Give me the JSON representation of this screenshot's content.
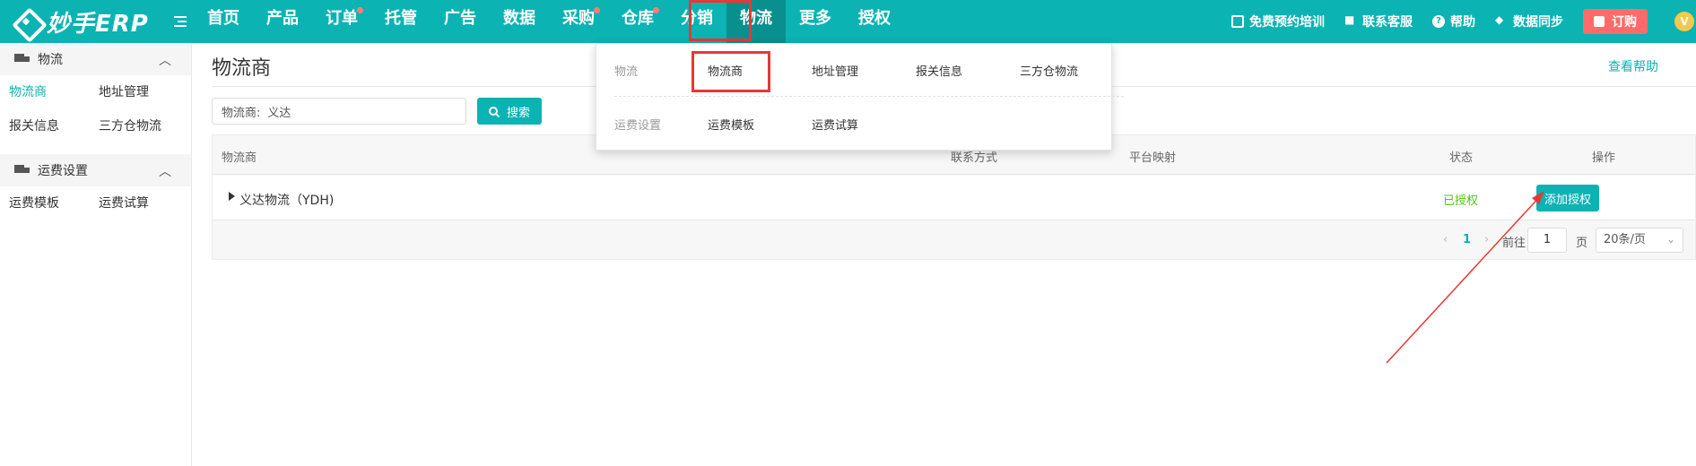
{
  "brand": {
    "name": "妙手ERP"
  },
  "nav": {
    "items": [
      {
        "label": "首页",
        "dot": false
      },
      {
        "label": "产品",
        "dot": false
      },
      {
        "label": "订单",
        "dot": true
      },
      {
        "label": "托管",
        "dot": false
      },
      {
        "label": "广告",
        "dot": false
      },
      {
        "label": "数据",
        "dot": false
      },
      {
        "label": "采购",
        "dot": true
      },
      {
        "label": "仓库",
        "dot": true
      },
      {
        "label": "分销",
        "dot": false
      },
      {
        "label": "物流",
        "dot": false
      },
      {
        "label": "更多",
        "dot": false
      },
      {
        "label": "授权",
        "dot": false
      }
    ],
    "active": "物流"
  },
  "toolbar": {
    "training": "免费预约培训",
    "support": "联系客服",
    "help": "帮助",
    "sync": "数据同步",
    "order": "订购",
    "avatar_letter": "V"
  },
  "dropdown": {
    "group1": "物流",
    "group1_links": [
      "物流商",
      "地址管理",
      "报关信息",
      "三方仓物流"
    ],
    "group2": "运费设置",
    "group2_links": [
      "运费模板",
      "运费试算"
    ]
  },
  "sidebar": {
    "group1": "物流",
    "group1_links": [
      "物流商",
      "地址管理",
      "报关信息",
      "三方仓物流"
    ],
    "group2": "运费设置",
    "group2_links": [
      "运费模板",
      "运费试算"
    ],
    "active": "物流商"
  },
  "page": {
    "title": "物流商",
    "help_link": "查看帮助"
  },
  "search": {
    "label": "物流商:",
    "value": "义达",
    "button": "搜索"
  },
  "table": {
    "columns": [
      "物流商",
      "联系方式",
      "平台映射",
      "状态",
      "操作"
    ],
    "rows": [
      {
        "name": "义达物流（YDH)",
        "contact": "",
        "mapping": "",
        "status": "已授权",
        "action": "添加授权"
      }
    ]
  },
  "pagination": {
    "prev": "‹",
    "current": "1",
    "next": "›",
    "goto_label": "前往",
    "goto_value": "1",
    "page_suffix": "页",
    "page_size": "20条/页"
  },
  "colors": {
    "brand": "#0bb3b3",
    "highlight": "#e53935",
    "status_ok": "#52c41a",
    "order_btn": "#ff6b6b"
  }
}
